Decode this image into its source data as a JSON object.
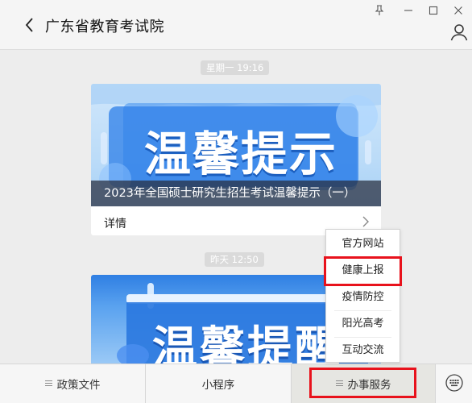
{
  "window": {
    "title": "广东省教育考试院",
    "pin_icon": "pin-icon",
    "minimize_icon": "minimize-icon",
    "maximize_icon": "maximize-icon",
    "close_icon": "close-icon"
  },
  "messages": [
    {
      "time": "星期一  19:16",
      "banner_text": "温馨提示",
      "caption": "2023年全国硕士研究生招生考试温馨提示（一）",
      "detail_label": "详情"
    },
    {
      "time": "昨天  12:50",
      "banner_text": "温馨提醒"
    }
  ],
  "menu": {
    "items": [
      "政策文件",
      "小程序",
      "办事服务"
    ],
    "active_index": 2
  },
  "popup": {
    "items": [
      "官方网站",
      "健康上报",
      "疫情防控",
      "阳光高考",
      "互动交流"
    ],
    "highlighted_index": 1
  },
  "colors": {
    "highlight_box": "#e8121c",
    "chip_bg": "#dadada",
    "banner_blue": "#2f7fe3"
  }
}
